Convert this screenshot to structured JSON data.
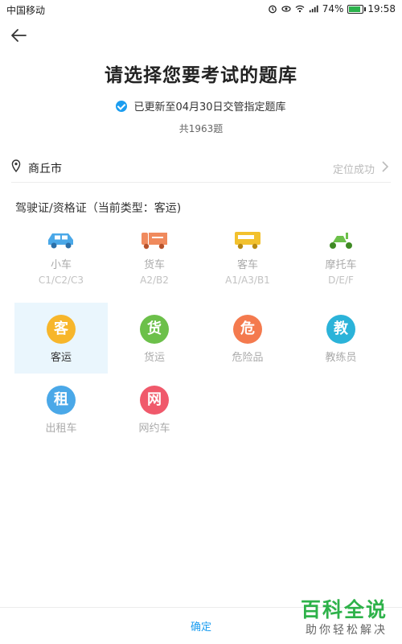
{
  "status_bar": {
    "carrier": "中国移动",
    "battery": "74%",
    "time": "19:58",
    "battery_level": 0.74
  },
  "header": {
    "title": "请选择您要考试的题库",
    "notice": "已更新至04月30日交管指定题库",
    "count": "共1963题"
  },
  "location": {
    "city": "商丘市",
    "status": "定位成功"
  },
  "section_title": "驾驶证/资格证（当前类型：客运)",
  "license_types": [
    {
      "label": "小车",
      "sub": "C1/C2/C3",
      "icon": "car-icon",
      "color": "#4aa8e8"
    },
    {
      "label": "货车",
      "sub": "A2/B2",
      "icon": "truck-icon",
      "color": "#f08a5d"
    },
    {
      "label": "客车",
      "sub": "A1/A3/B1",
      "icon": "bus-icon",
      "color": "#f2c12e"
    },
    {
      "label": "摩托车",
      "sub": "D/E/F",
      "icon": "motorcycle-icon",
      "color": "#6cc04a"
    }
  ],
  "qualifications": [
    {
      "label": "客运",
      "char": "客",
      "color": "#f7b62b",
      "selected": true
    },
    {
      "label": "货运",
      "char": "货",
      "color": "#6cc04a"
    },
    {
      "label": "危险品",
      "char": "危",
      "color": "#f47a4e"
    },
    {
      "label": "教练员",
      "char": "教",
      "color": "#2bb3d9"
    },
    {
      "label": "出租车",
      "char": "租",
      "color": "#4aa8e8"
    },
    {
      "label": "网约车",
      "char": "网",
      "color": "#f0596b"
    }
  ],
  "footer": {
    "confirm": "确定"
  },
  "watermark": {
    "brand": "百科全说",
    "slogan": "助你轻松解决"
  }
}
